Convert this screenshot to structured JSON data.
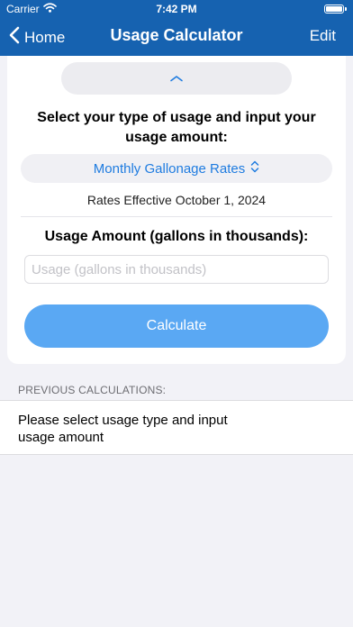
{
  "status_bar": {
    "carrier": "Carrier",
    "time": "7:42 PM"
  },
  "nav": {
    "back_label": "Home",
    "title": "Usage Calculator",
    "edit_label": "Edit"
  },
  "form": {
    "instruction": "Select your type of usage and input your usage amount:",
    "usage_type": "Monthly Gallonage Rates",
    "rates_effective": "Rates Effective October 1, 2024",
    "usage_label": "Usage Amount (gallons in thousands):",
    "usage_value": "",
    "usage_placeholder": "Usage (gallons in thousands)",
    "calculate_label": "Calculate"
  },
  "previous": {
    "header": "PREVIOUS CALCULATIONS:",
    "message": "Please select usage type and input usage amount"
  },
  "colors": {
    "nav_background": "#1662b0",
    "accent": "#1f7ce0",
    "button": "#5aa8f3",
    "page_background": "#f2f2f7"
  },
  "icons": {
    "wifi": "wifi-icon",
    "battery": "battery-icon",
    "back": "chevron-left-icon",
    "collapse": "chevron-up-icon",
    "select": "chevron-up-down-icon"
  }
}
